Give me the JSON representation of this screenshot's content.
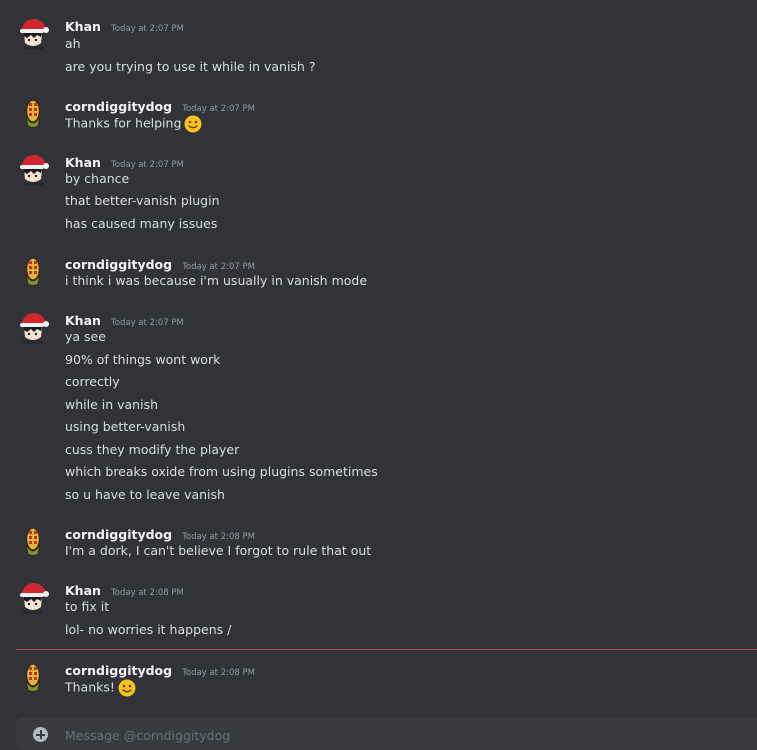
{
  "composer": {
    "placeholder": "Message @corndiggitydog"
  },
  "messages": [
    {
      "author": "Khan",
      "time": "Today at 2:07 PM",
      "lines": [
        "ah",
        "are you trying to use it while in vanish ?"
      ]
    },
    {
      "author": "corndiggitydog",
      "time": "Today at 2:07 PM",
      "lines": [
        "Thanks for helping"
      ],
      "emoji": "slightly-smiling-face"
    },
    {
      "author": "Khan",
      "time": "Today at 2:07 PM",
      "lines": [
        "by chance",
        "that better-vanish plugin",
        "has caused many issues"
      ]
    },
    {
      "author": "corndiggitydog",
      "time": "Today at 2:07 PM",
      "lines": [
        "i think i was because i'm usually in vanish mode"
      ]
    },
    {
      "author": "Khan",
      "time": "Today at 2:07 PM",
      "lines": [
        "ya see",
        "90% of things wont work",
        "correctly",
        "while in vanish",
        "using better-vanish",
        "cuss they modify the player",
        "which breaks oxide from using plugins sometimes",
        "so u have to leave vanish"
      ]
    },
    {
      "author": "corndiggitydog",
      "time": "Today at 2:08 PM",
      "lines": [
        "I'm a dork, I can't believe I forgot to rule that out"
      ]
    },
    {
      "author": "Khan",
      "time": "Today at 2:08 PM",
      "lines": [
        "to fix it",
        "lol- no worries it happens /"
      ]
    },
    {
      "author": "corndiggitydog",
      "time": "Today at 2:08 PM",
      "lines": [
        "Thanks!"
      ],
      "emoji": "slightly-smiling-face"
    }
  ],
  "colors": {
    "background": "#313338",
    "username": "#f2f3f5",
    "text": "#dbdee1",
    "timestamp": "#949ba4",
    "new_message_divider": "#c8444b",
    "composer": "#383a40"
  }
}
